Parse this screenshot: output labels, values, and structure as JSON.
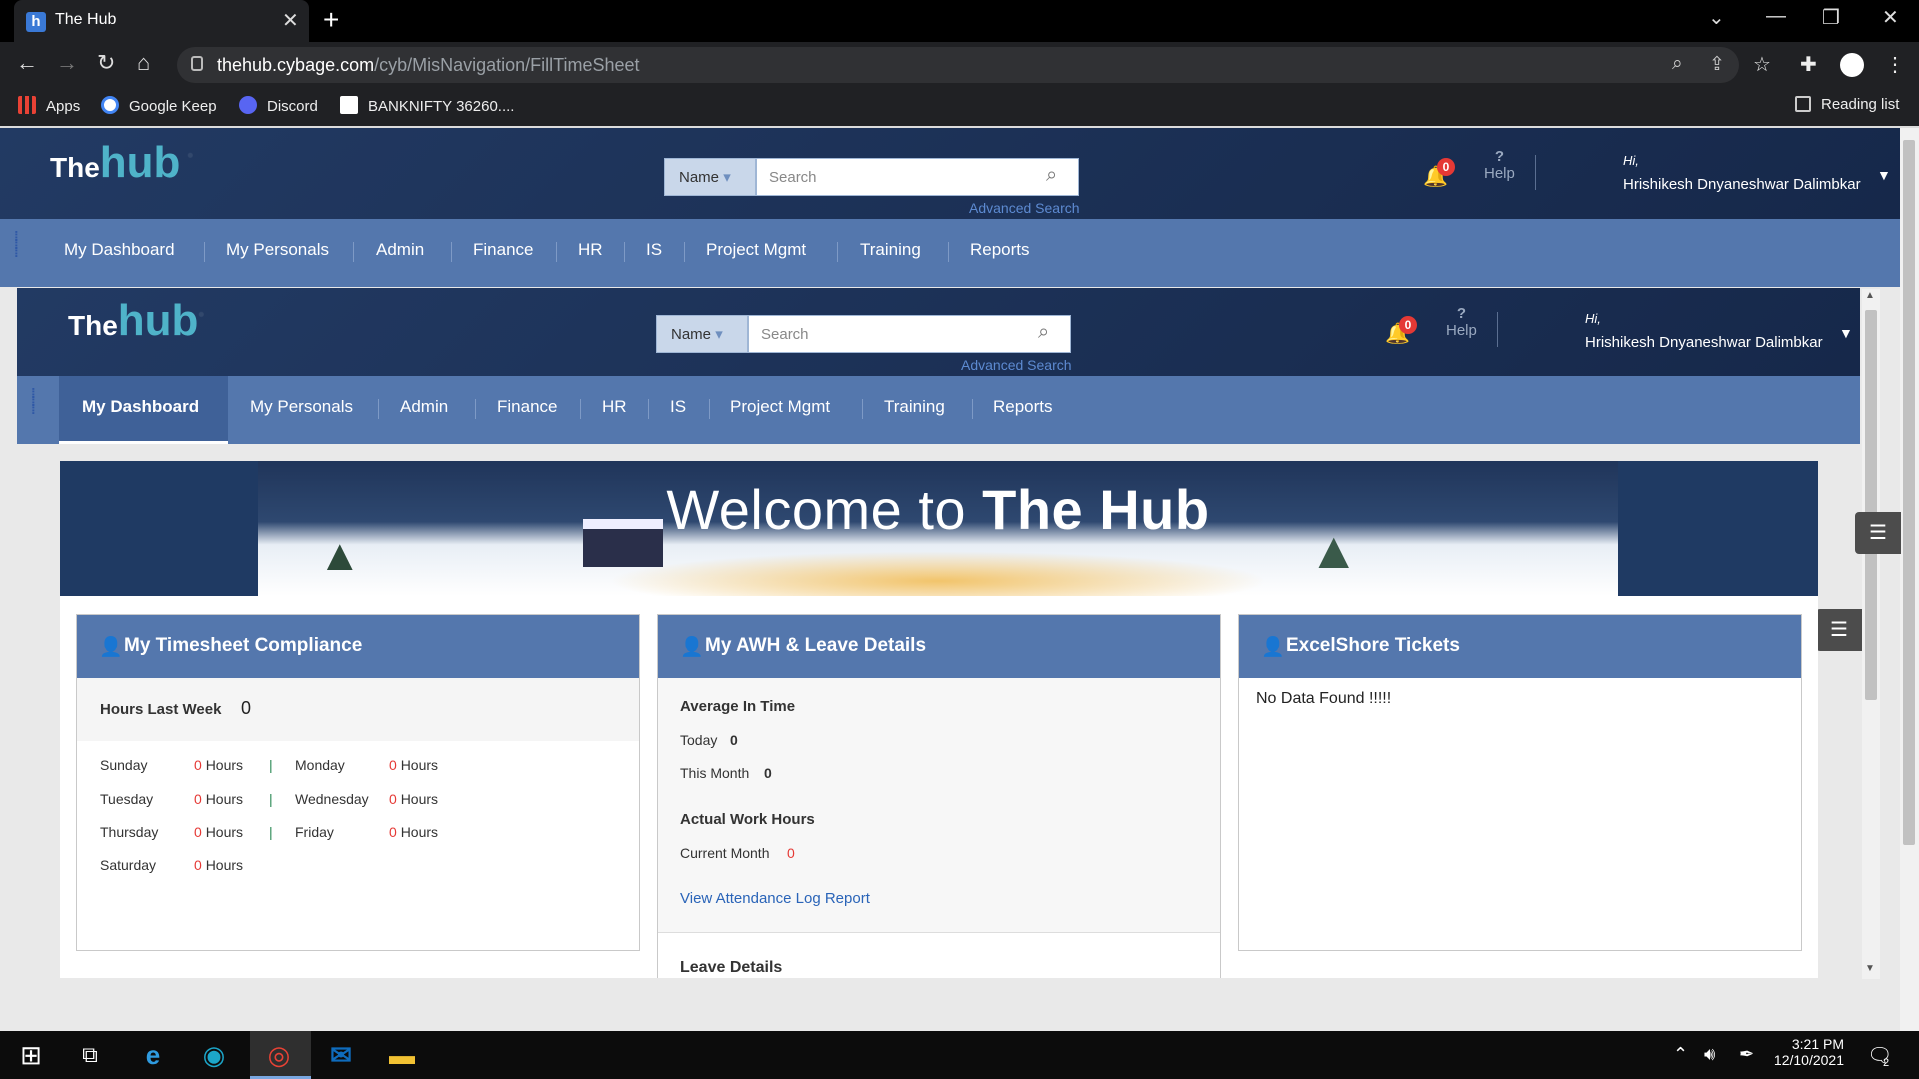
{
  "browser": {
    "tab_title": "The Hub",
    "favicon_letter": "h",
    "url_host": "thehub.cybage.com",
    "url_path": "/cyb/MisNavigation/FillTimeSheet",
    "bookmarks": [
      {
        "label": "Apps",
        "icon": "apps-grid-icon"
      },
      {
        "label": "Google Keep",
        "icon": "google-icon"
      },
      {
        "label": "Discord",
        "icon": "discord-icon"
      },
      {
        "label": "BANKNIFTY 36260....",
        "icon": "tradingview-icon"
      }
    ],
    "reading_list": "Reading list"
  },
  "site": {
    "logo_the": "The",
    "logo_hub": "hub",
    "search_scope": "Name",
    "search_placeholder": "Search",
    "advanced_search": "Advanced Search",
    "notifications_count": "0",
    "help_label": "Help",
    "greeting": "Hi,",
    "user_name": "Hrishikesh Dnyaneshwar Dalimbkar",
    "menu": [
      "My Dashboard",
      "My Personals",
      "Admin",
      "Finance",
      "HR",
      "IS",
      "Project Mgmt",
      "Training",
      "Reports"
    ],
    "active_menu": "My Dashboard"
  },
  "banner": {
    "welcome": "Welcome to",
    "brand": "The Hub"
  },
  "timesheet": {
    "title": "My Timesheet Compliance",
    "hours_last_week_label": "Hours Last Week",
    "hours_last_week_value": "0",
    "unit": "Hours",
    "days": [
      {
        "day": "Sunday",
        "hours": "0"
      },
      {
        "day": "Monday",
        "hours": "0"
      },
      {
        "day": "Tuesday",
        "hours": "0"
      },
      {
        "day": "Wednesday",
        "hours": "0"
      },
      {
        "day": "Thursday",
        "hours": "0"
      },
      {
        "day": "Friday",
        "hours": "0"
      },
      {
        "day": "Saturday",
        "hours": "0"
      }
    ]
  },
  "awh": {
    "title": "My AWH & Leave Details",
    "avg_in_time_label": "Average In Time",
    "today_label": "Today",
    "today_value": "0",
    "month_label": "This Month",
    "month_value": "0",
    "actual_hours_label": "Actual Work Hours",
    "current_month_label": "Current Month",
    "current_month_value": "0",
    "view_link": "View Attendance Log Report",
    "leave_details": "Leave Details"
  },
  "excelshore": {
    "title": "ExcelShore Tickets",
    "empty": "No Data Found !!!!!"
  },
  "taskbar": {
    "time": "3:21 PM",
    "date": "12/10/2021",
    "notifications": "2"
  }
}
